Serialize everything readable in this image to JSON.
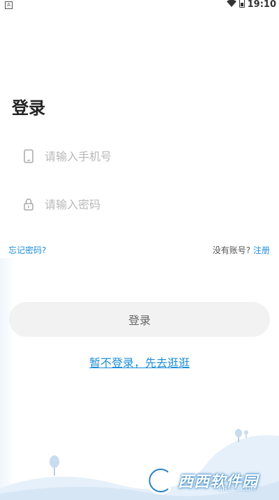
{
  "status_bar": {
    "app_indicator": "A",
    "time": "19:10",
    "icons": [
      "wifi-icon",
      "battery-icon"
    ]
  },
  "login": {
    "title": "登录",
    "phone": {
      "placeholder": "请输入手机号",
      "value": "",
      "icon": "phone-icon"
    },
    "password": {
      "placeholder": "请输入密码",
      "value": "",
      "icon": "lock-icon"
    },
    "forgot_password": "忘记密码?",
    "no_account": "没有账号?",
    "register": "注册",
    "login_button": "登录",
    "skip_login": "暂不登录，先去逛逛"
  },
  "watermark": {
    "text": "西西软件园",
    "sub": "CR173.COM"
  },
  "colors": {
    "accent": "#1c8ed8",
    "button_bg": "#f2f2f2",
    "hill": "#dce9f6"
  }
}
